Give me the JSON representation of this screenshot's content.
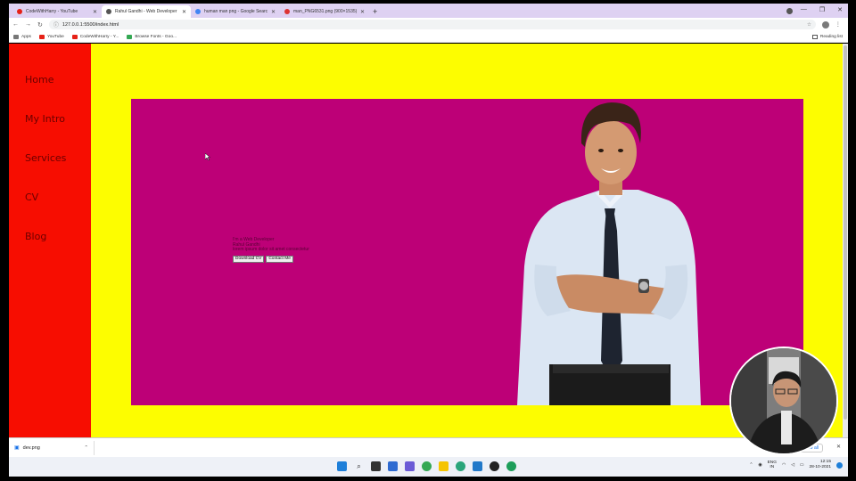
{
  "browser": {
    "tabs": [
      {
        "title": "CodeWithHarry - YouTube",
        "color": "#e62117",
        "active": false
      },
      {
        "title": "Rahul Gandhi - Web Developer",
        "color": "#555555",
        "active": true
      },
      {
        "title": "human man png - Google Search",
        "color": "#4285f4",
        "active": false
      },
      {
        "title": "man_PNG6531.png (900×1535)",
        "color": "#d33",
        "active": false
      }
    ],
    "new_tab": "+",
    "url": "127.0.0.1:5500/index.html",
    "bookmarks": [
      {
        "label": "Apps",
        "color": "#555555"
      },
      {
        "label": "YouTube",
        "color": "#e62117"
      },
      {
        "label": "CodeWithHarry - Y...",
        "color": "#e62117"
      },
      {
        "label": "Browse Fonts - Goo...",
        "color": "#34a853"
      }
    ],
    "reading_list": "Reading list"
  },
  "page": {
    "nav": [
      "Home",
      "My Intro",
      "Services",
      "CV",
      "Blog"
    ],
    "intro_lines": [
      "I'm a Web Developer",
      "Rahul Gandhi",
      "lorem ipsum dolor sit amet consectetur"
    ],
    "buttons": {
      "download_cv": "Download CV",
      "contact_me": "Contact Me"
    },
    "colors": {
      "sidebar": "#f70d01",
      "frame": "#fdfd00",
      "hero": "#bd0077"
    }
  },
  "downloads": {
    "file": "dev.png",
    "show_all": "Show all"
  },
  "taskbar": {
    "lang_top": "ENG",
    "lang_bottom": "IN",
    "time": "12:15",
    "date": "28-10-2021"
  }
}
